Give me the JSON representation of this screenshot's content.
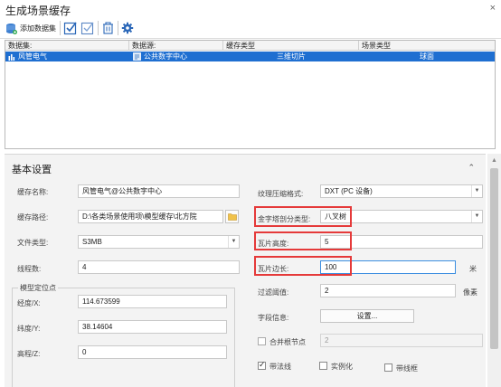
{
  "window": {
    "title": "生成场景缓存",
    "close_glyph": "×"
  },
  "toolbar": {
    "add_dataset_label": "添加数据集"
  },
  "table": {
    "headers": [
      "数据集:",
      "数据源:",
      "缓存类型",
      "场景类型"
    ],
    "rows": [
      {
        "dataset": "风管电气",
        "datasource": "公共数字中心",
        "cache_type": "三维切片",
        "scene_type": "球面"
      }
    ]
  },
  "panel": {
    "title": "基本设置",
    "collapse_glyph": "⌃",
    "left": {
      "cache_name_label": "缓存名称:",
      "cache_name_value": "风管电气@公共数字中心",
      "cache_path_label": "缓存路径:",
      "cache_path_value": "D:\\各类场景使用项\\模型缓存\\北方院",
      "file_type_label": "文件类型:",
      "file_type_value": "S3MB",
      "thread_label": "线程数:",
      "thread_value": "4",
      "anchor_group_label": "模型定位点",
      "lon_label": "经度/X:",
      "lon_value": "114.673599",
      "lat_label": "纬度/Y:",
      "lat_value": "38.14604",
      "elev_label": "高程/Z:",
      "elev_value": "0"
    },
    "right": {
      "texture_label": "纹理压缩格式:",
      "texture_value": "DXT (PC 设备)",
      "pyramid_label": "金字塔剖分类型:",
      "pyramid_value": "八叉树",
      "tile_height_label": "瓦片高度:",
      "tile_height_value": "5",
      "tile_side_label": "瓦片边长:",
      "tile_side_value": "100",
      "tile_side_unit": "米",
      "filter_label": "过滤阈值:",
      "filter_value": "2",
      "filter_unit": "像素",
      "field_info_label": "字段信息:",
      "field_settings_button": "设置...",
      "merge_root_label": "合并根节点",
      "merge_root_value": "2",
      "normal_label": "带法线",
      "instance_label": "实例化",
      "border_label": "带线框"
    }
  },
  "colors": {
    "selection": "#1f6fd1",
    "highlight_box": "#e53a3a",
    "toolbar_icon": "#2a67b8"
  }
}
